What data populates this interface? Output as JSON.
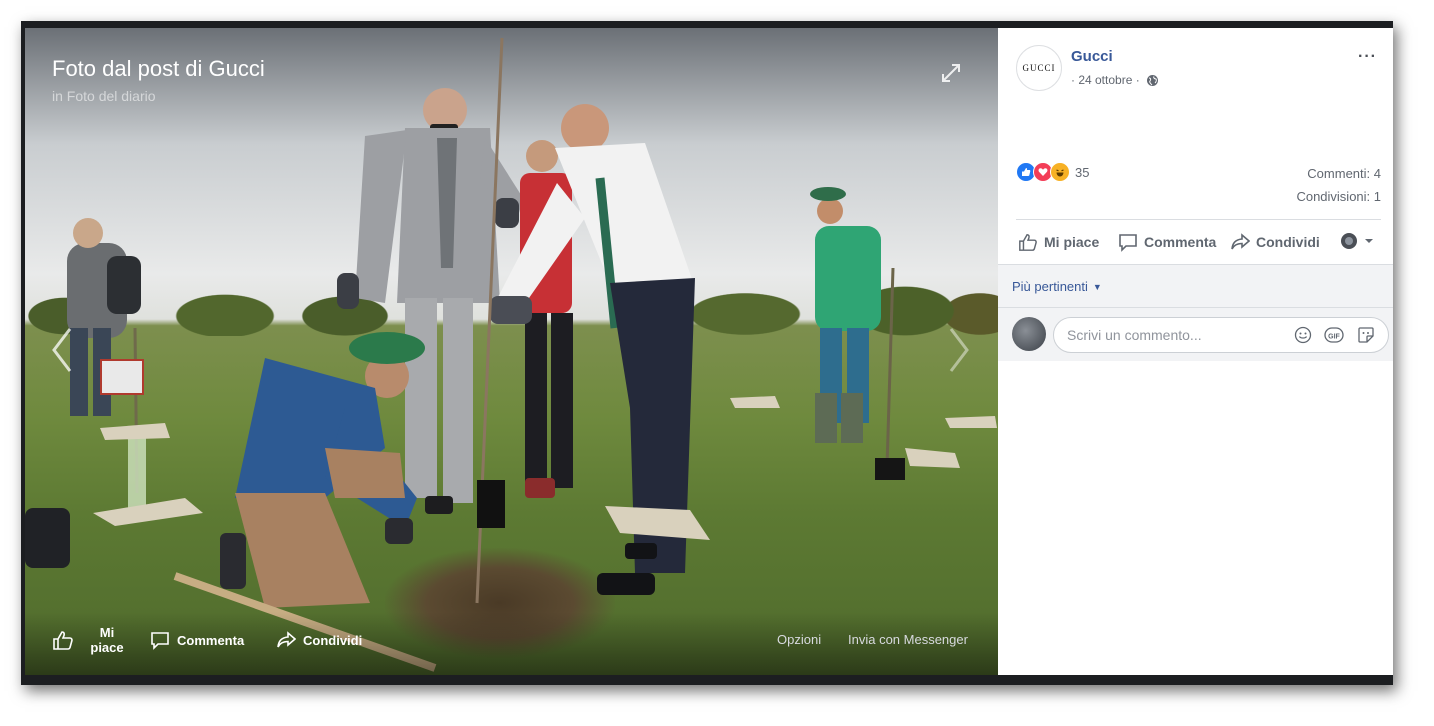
{
  "photo": {
    "title": "Foto dal post di Gucci",
    "subtitle": "in Foto del diario",
    "actions": {
      "like": "Mi piace",
      "comment": "Commenta",
      "share": "Condividi",
      "options": "Opzioni",
      "messenger": "Invia con Messenger"
    }
  },
  "post": {
    "page_name": "Gucci",
    "avatar_text": "GUCCI",
    "date": "· 24 ottobre ·",
    "more": "···",
    "reactions_count": "35",
    "comments": "Commenti: 4",
    "shares": "Condivisioni: 1",
    "actions": {
      "like": "Mi piace",
      "comment": "Commenta",
      "share": "Condividi"
    },
    "sort_label": "Più pertinenti",
    "comment_placeholder": "Scrivi un commento...",
    "gif_label": "GIF"
  },
  "colors": {
    "link": "#385898",
    "like_blue": "#2078f4",
    "love_red": "#f33e58",
    "haha_yellow": "#f7b125"
  }
}
